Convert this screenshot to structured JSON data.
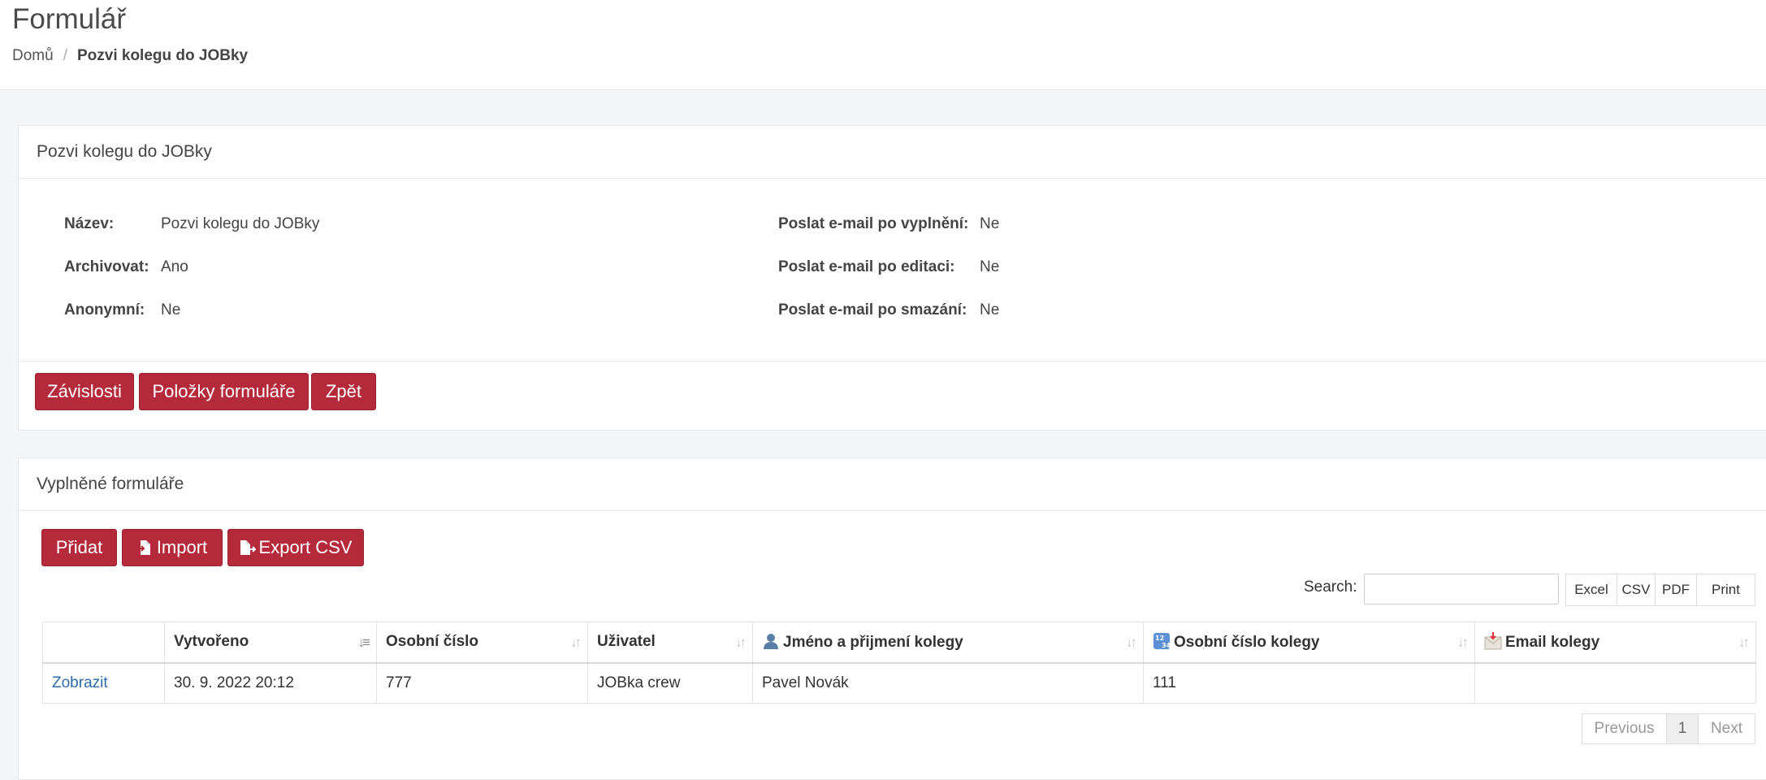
{
  "header": {
    "title": "Formulář",
    "breadcrumb": {
      "home": "Domů",
      "separator": "/",
      "current": "Pozvi kolegu do JOBky"
    }
  },
  "form_panel": {
    "title": "Pozvi kolegu do JOBky",
    "left_details": [
      {
        "label": "Název:",
        "value": "Pozvi kolegu do JOBky"
      },
      {
        "label": "Archivovat:",
        "value": "Ano"
      },
      {
        "label": "Anonymní:",
        "value": "Ne"
      }
    ],
    "right_details": [
      {
        "label": "Poslat e-mail po vyplnění:",
        "value": "Ne"
      },
      {
        "label": "Poslat e-mail po editaci:",
        "value": "Ne"
      },
      {
        "label": "Poslat e-mail po smazání:",
        "value": "Ne"
      }
    ],
    "buttons": {
      "dependencies": "Závislosti",
      "form_items": "Položky formuláře",
      "back": "Zpět"
    }
  },
  "filled_panel": {
    "title": "Vyplněné formuláře",
    "buttons": {
      "add": "Přidat",
      "import": "Import",
      "export": "Export CSV"
    },
    "search_label": "Search:",
    "search_value": "",
    "export_buttons": {
      "excel": "Excel",
      "csv": "CSV",
      "pdf": "PDF",
      "print": "Print"
    },
    "table": {
      "columns": [
        "",
        "Vytvořeno",
        "Osobní číslo",
        "Uživatel",
        "Jméno a přijmení kolegy",
        "Osobní číslo kolegy",
        "Email kolegy"
      ],
      "column_icons": [
        "",
        "",
        "",
        "",
        "person-icon",
        "numbers-icon",
        "envelope-icon"
      ],
      "rows": [
        [
          "Zobrazit",
          "30. 9. 2022 20:12",
          "777",
          "JOBka crew",
          "Pavel Novák",
          "111",
          ""
        ]
      ]
    },
    "pagination": {
      "previous": "Previous",
      "current": "1",
      "next": "Next"
    }
  },
  "colors": {
    "primary_button": "#b52a3a",
    "link": "#2d6ca8",
    "background": "#f4f5f8"
  }
}
